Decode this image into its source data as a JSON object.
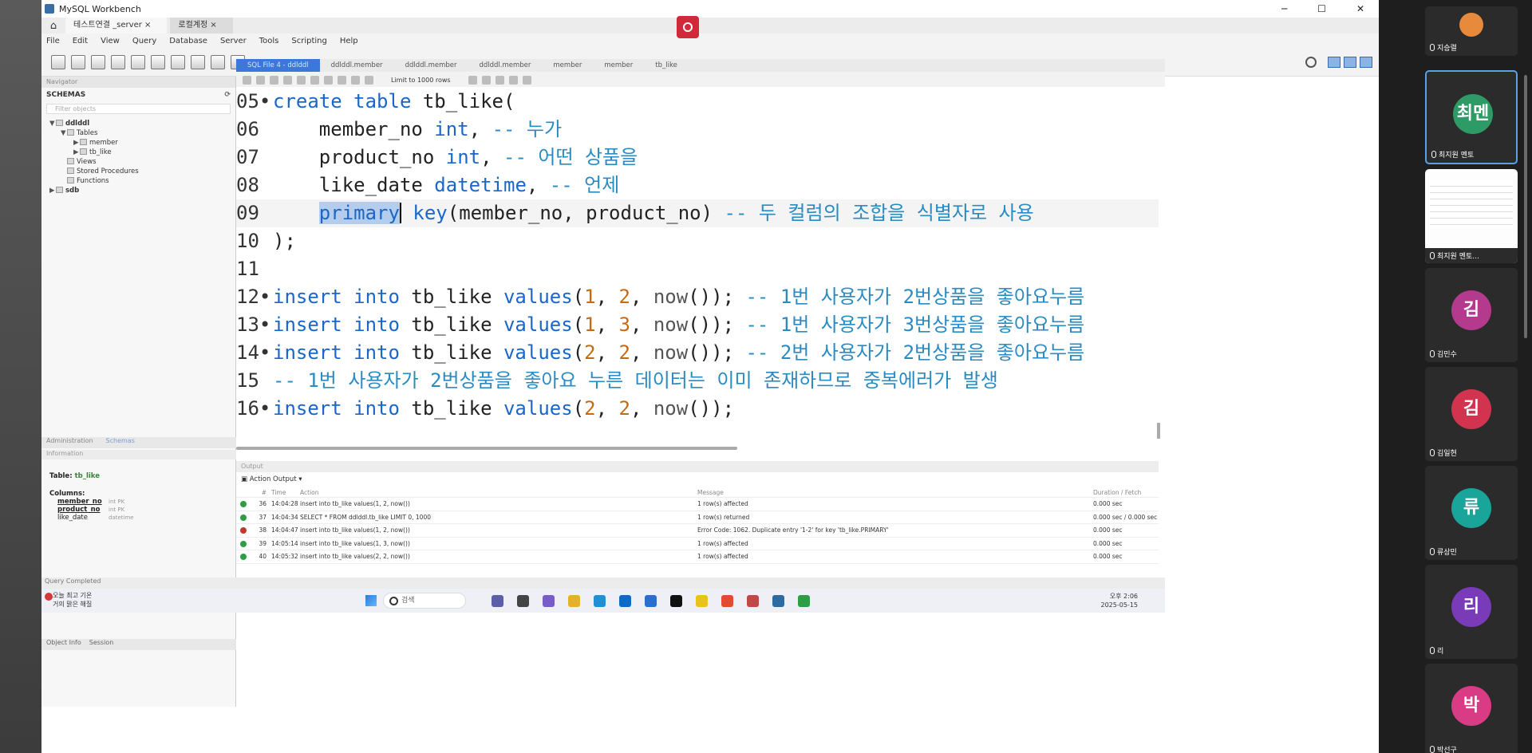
{
  "window": {
    "title": "MySQL Workbench",
    "controls": [
      "─",
      "☐",
      "✕"
    ]
  },
  "connection_tabs": [
    {
      "label": "테스트연결 _server ×",
      "active": true
    },
    {
      "label": "로컬계정 ×",
      "active": false
    }
  ],
  "menu": [
    "File",
    "Edit",
    "View",
    "Query",
    "Database",
    "Server",
    "Tools",
    "Scripting",
    "Help"
  ],
  "sidebar": {
    "navigator_label": "Navigator",
    "schemas_title": "SCHEMAS",
    "filter_placeholder": "Filter objects",
    "tree": [
      {
        "label": "ddlddl",
        "level": 1,
        "twisty": "▼"
      },
      {
        "label": "Tables",
        "level": 2,
        "twisty": "▼"
      },
      {
        "label": "member",
        "level": 3,
        "twisty": "▶"
      },
      {
        "label": "tb_like",
        "level": 3,
        "twisty": "▶"
      },
      {
        "label": "Views",
        "level": 2,
        "twisty": ""
      },
      {
        "label": "Stored Procedures",
        "level": 2,
        "twisty": ""
      },
      {
        "label": "Functions",
        "level": 2,
        "twisty": ""
      },
      {
        "label": "sdb",
        "level": 1,
        "twisty": "▶"
      }
    ],
    "tabs": [
      "Administration",
      "Schemas"
    ],
    "info_header": "Information",
    "info": {
      "table_label": "Table:",
      "table_name": "tb_like",
      "columns_label": "Columns:",
      "columns": [
        {
          "name": "member_no",
          "type": "int PK"
        },
        {
          "name": "product_no",
          "type": "int PK"
        },
        {
          "name": "like_date",
          "type": "datetime"
        }
      ]
    },
    "bottom_tabs": [
      "Object Info",
      "Session"
    ]
  },
  "editor": {
    "tabs": [
      "SQL File 4 - ddlddl",
      "ddlddl.member",
      "ddlddl.member",
      "ddlddl.member",
      "member",
      "member",
      "tb_like"
    ],
    "limit_label": "Limit to 1000 rows",
    "lines": [
      {
        "n": "05",
        "marker": "•",
        "highlight": false,
        "tokens": [
          {
            "t": "create table ",
            "c": "kw"
          },
          {
            "t": "tb_like(",
            "c": "id"
          }
        ]
      },
      {
        "n": "06",
        "marker": " ",
        "highlight": false,
        "tokens": [
          {
            "t": "    member_no ",
            "c": "id"
          },
          {
            "t": "int",
            "c": "kw"
          },
          {
            "t": ", ",
            "c": "id"
          },
          {
            "t": "-- 누가",
            "c": "cm"
          }
        ]
      },
      {
        "n": "07",
        "marker": " ",
        "highlight": false,
        "tokens": [
          {
            "t": "    product_no ",
            "c": "id"
          },
          {
            "t": "int",
            "c": "kw"
          },
          {
            "t": ", ",
            "c": "id"
          },
          {
            "t": "-- 어떤 상품을",
            "c": "cm"
          }
        ]
      },
      {
        "n": "08",
        "marker": " ",
        "highlight": false,
        "tokens": [
          {
            "t": "    like_date ",
            "c": "id"
          },
          {
            "t": "datetime",
            "c": "kw"
          },
          {
            "t": ", ",
            "c": "id"
          },
          {
            "t": "-- 언제",
            "c": "cm"
          }
        ]
      },
      {
        "n": "09",
        "marker": " ",
        "highlight": true,
        "tokens": [
          {
            "t": "    ",
            "c": "id"
          },
          {
            "t": "primary",
            "c": "kw sel"
          },
          {
            "t": "",
            "c": "caret"
          },
          {
            "t": " key",
            "c": "kw"
          },
          {
            "t": "(member_no, product_no) ",
            "c": "id"
          },
          {
            "t": "-- 두 컬럼의 조합을 식별자로 사용",
            "c": "cm"
          }
        ]
      },
      {
        "n": "10",
        "marker": " ",
        "highlight": false,
        "tokens": [
          {
            "t": ");",
            "c": "id"
          }
        ]
      },
      {
        "n": "11",
        "marker": " ",
        "highlight": false,
        "tokens": []
      },
      {
        "n": "12",
        "marker": "•",
        "highlight": false,
        "tokens": [
          {
            "t": "insert into ",
            "c": "kw"
          },
          {
            "t": "tb_like ",
            "c": "id"
          },
          {
            "t": "values",
            "c": "kw"
          },
          {
            "t": "(",
            "c": "id"
          },
          {
            "t": "1",
            "c": "num"
          },
          {
            "t": ", ",
            "c": "id"
          },
          {
            "t": "2",
            "c": "num"
          },
          {
            "t": ", ",
            "c": "id"
          },
          {
            "t": "now",
            "c": "fn"
          },
          {
            "t": "()); ",
            "c": "id"
          },
          {
            "t": "-- 1번 사용자가 2번상품을 좋아요누름",
            "c": "cm"
          }
        ]
      },
      {
        "n": "13",
        "marker": "•",
        "highlight": false,
        "tokens": [
          {
            "t": "insert into ",
            "c": "kw"
          },
          {
            "t": "tb_like ",
            "c": "id"
          },
          {
            "t": "values",
            "c": "kw"
          },
          {
            "t": "(",
            "c": "id"
          },
          {
            "t": "1",
            "c": "num"
          },
          {
            "t": ", ",
            "c": "id"
          },
          {
            "t": "3",
            "c": "num"
          },
          {
            "t": ", ",
            "c": "id"
          },
          {
            "t": "now",
            "c": "fn"
          },
          {
            "t": "()); ",
            "c": "id"
          },
          {
            "t": "-- 1번 사용자가 3번상품을 좋아요누름",
            "c": "cm"
          }
        ]
      },
      {
        "n": "14",
        "marker": "•",
        "highlight": false,
        "tokens": [
          {
            "t": "insert into ",
            "c": "kw"
          },
          {
            "t": "tb_like ",
            "c": "id"
          },
          {
            "t": "values",
            "c": "kw"
          },
          {
            "t": "(",
            "c": "id"
          },
          {
            "t": "2",
            "c": "num"
          },
          {
            "t": ", ",
            "c": "id"
          },
          {
            "t": "2",
            "c": "num"
          },
          {
            "t": ", ",
            "c": "id"
          },
          {
            "t": "now",
            "c": "fn"
          },
          {
            "t": "()); ",
            "c": "id"
          },
          {
            "t": "-- 2번 사용자가 2번상품을 좋아요누름",
            "c": "cm"
          }
        ]
      },
      {
        "n": "15",
        "marker": " ",
        "highlight": false,
        "tokens": [
          {
            "t": "-- 1번 사용자가 2번상품을 좋아요 누른 데이터는 이미 존재하므로 중복에러가 발생",
            "c": "cm"
          }
        ]
      },
      {
        "n": "16",
        "marker": "•",
        "highlight": false,
        "tokens": [
          {
            "t": "insert into ",
            "c": "kw"
          },
          {
            "t": "tb_like ",
            "c": "id"
          },
          {
            "t": "values",
            "c": "kw"
          },
          {
            "t": "(",
            "c": "id"
          },
          {
            "t": "2",
            "c": "num"
          },
          {
            "t": ", ",
            "c": "id"
          },
          {
            "t": "2",
            "c": "num"
          },
          {
            "t": ", ",
            "c": "id"
          },
          {
            "t": "now",
            "c": "fn"
          },
          {
            "t": "());",
            "c": "id"
          }
        ]
      }
    ]
  },
  "output": {
    "header": "Output",
    "selector": "Action Output",
    "columns": [
      "#",
      "Time",
      "Action",
      "Message",
      "Duration / Fetch"
    ],
    "rows": [
      {
        "status": "ok",
        "n": "36",
        "time": "14:04:28",
        "action": "insert into tb_like values(1, 2, now())",
        "message": "1 row(s) affected",
        "duration": "0.000 sec"
      },
      {
        "status": "ok",
        "n": "37",
        "time": "14:04:34",
        "action": "SELECT * FROM ddlddl.tb_like LIMIT 0, 1000",
        "message": "1 row(s) returned",
        "duration": "0.000 sec / 0.000 sec"
      },
      {
        "status": "err",
        "n": "38",
        "time": "14:04:47",
        "action": "insert into tb_like values(1, 2, now())",
        "message": "Error Code: 1062. Duplicate entry '1-2' for key 'tb_like.PRIMARY'",
        "duration": "0.000 sec"
      },
      {
        "status": "ok",
        "n": "39",
        "time": "14:05:14",
        "action": "insert into tb_like values(1, 3, now())",
        "message": "1 row(s) affected",
        "duration": "0.000 sec"
      },
      {
        "status": "ok",
        "n": "40",
        "time": "14:05:32",
        "action": "insert into tb_like values(2, 2, now())",
        "message": "1 row(s) affected",
        "duration": "0.000 sec"
      }
    ]
  },
  "status_bar": "Query Completed",
  "taskbar": {
    "weather_line1": "오늘 최고 기온",
    "weather_line2": "거의 맑은 해질",
    "search_label": "검색",
    "time": "오후 2:06",
    "date": "2025-05-15",
    "app_colors": [
      "#5a5fa8",
      "#444444",
      "#7a5cc8",
      "#e3b22a",
      "#1f8fd6",
      "#0c6ac9",
      "#2a6fd0",
      "#111111",
      "#e8c41a",
      "#e24b32",
      "#c24848",
      "#2d6a9f",
      "#2e9e44"
    ]
  },
  "participants": [
    {
      "initial": "",
      "name": "지승렬",
      "color": "#e88a3c",
      "active": false,
      "kind": "small"
    },
    {
      "initial": "최멘",
      "name": "최지원 멘토",
      "color": "#2e9a66",
      "active": true,
      "kind": "avatar"
    },
    {
      "initial": "",
      "name": "최지원 멘토...",
      "color": "#ffffff",
      "active": false,
      "kind": "shot"
    },
    {
      "initial": "김",
      "name": "김민수",
      "color": "#b33a8c",
      "active": false,
      "kind": "avatar"
    },
    {
      "initial": "김",
      "name": "김일현",
      "color": "#d2344f",
      "active": false,
      "kind": "avatar"
    },
    {
      "initial": "류",
      "name": "류상민",
      "color": "#1aa59a",
      "active": false,
      "kind": "avatar"
    },
    {
      "initial": "리",
      "name": "리",
      "color": "#7a3bb8",
      "active": false,
      "kind": "avatar"
    },
    {
      "initial": "박",
      "name": "박선구",
      "color": "#d93b84",
      "active": false,
      "kind": "avatar"
    }
  ]
}
